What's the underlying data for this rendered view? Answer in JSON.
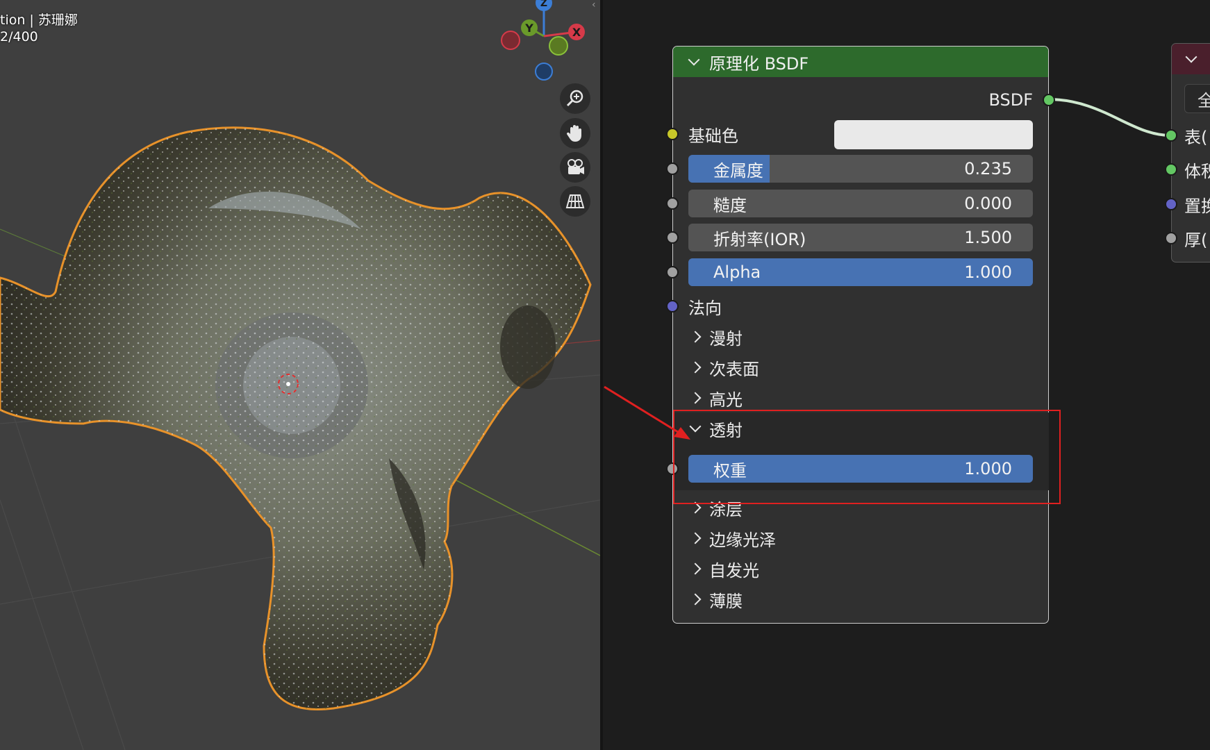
{
  "viewport": {
    "overlay_line1": "tion | 苏珊娜",
    "overlay_line2": "2/400",
    "gizmo": {
      "z": "Z",
      "y": "Y",
      "x": "X"
    },
    "nav_buttons": [
      "zoom-icon",
      "hand-icon",
      "camera-icon",
      "grid-icon"
    ]
  },
  "bsdf_node": {
    "title": "原理化 BSDF",
    "output_label": "BSDF",
    "base_color_label": "基础色",
    "metallic": {
      "label": "金属度",
      "value": "0.235",
      "fill": 0.235
    },
    "roughness": {
      "label": "糙度",
      "value": "0.000",
      "fill": 0.0
    },
    "ior": {
      "label": "折射率(IOR)",
      "value": "1.500",
      "fill": 0.0
    },
    "alpha": {
      "label": "Alpha",
      "value": "1.000",
      "fill": 1.0
    },
    "normal_label": "法向",
    "panels": {
      "diffuse": "漫射",
      "subsurface": "次表面",
      "specular": "高光",
      "transmission": "透射",
      "coat": "涂层",
      "sheen": "边缘光泽",
      "emission": "自发光",
      "thin_film": "薄膜"
    },
    "transmission_weight": {
      "label": "权重",
      "value": "1.000",
      "fill": 1.0
    }
  },
  "output_node": {
    "button_text": "全",
    "inputs": [
      "表(",
      "体积",
      "置换",
      "厚("
    ]
  },
  "colors": {
    "node_header_green": "#2d6a2c",
    "slider_blue": "#4772b3",
    "highlight_red": "#e02020",
    "selection_orange": "#e8922a"
  }
}
